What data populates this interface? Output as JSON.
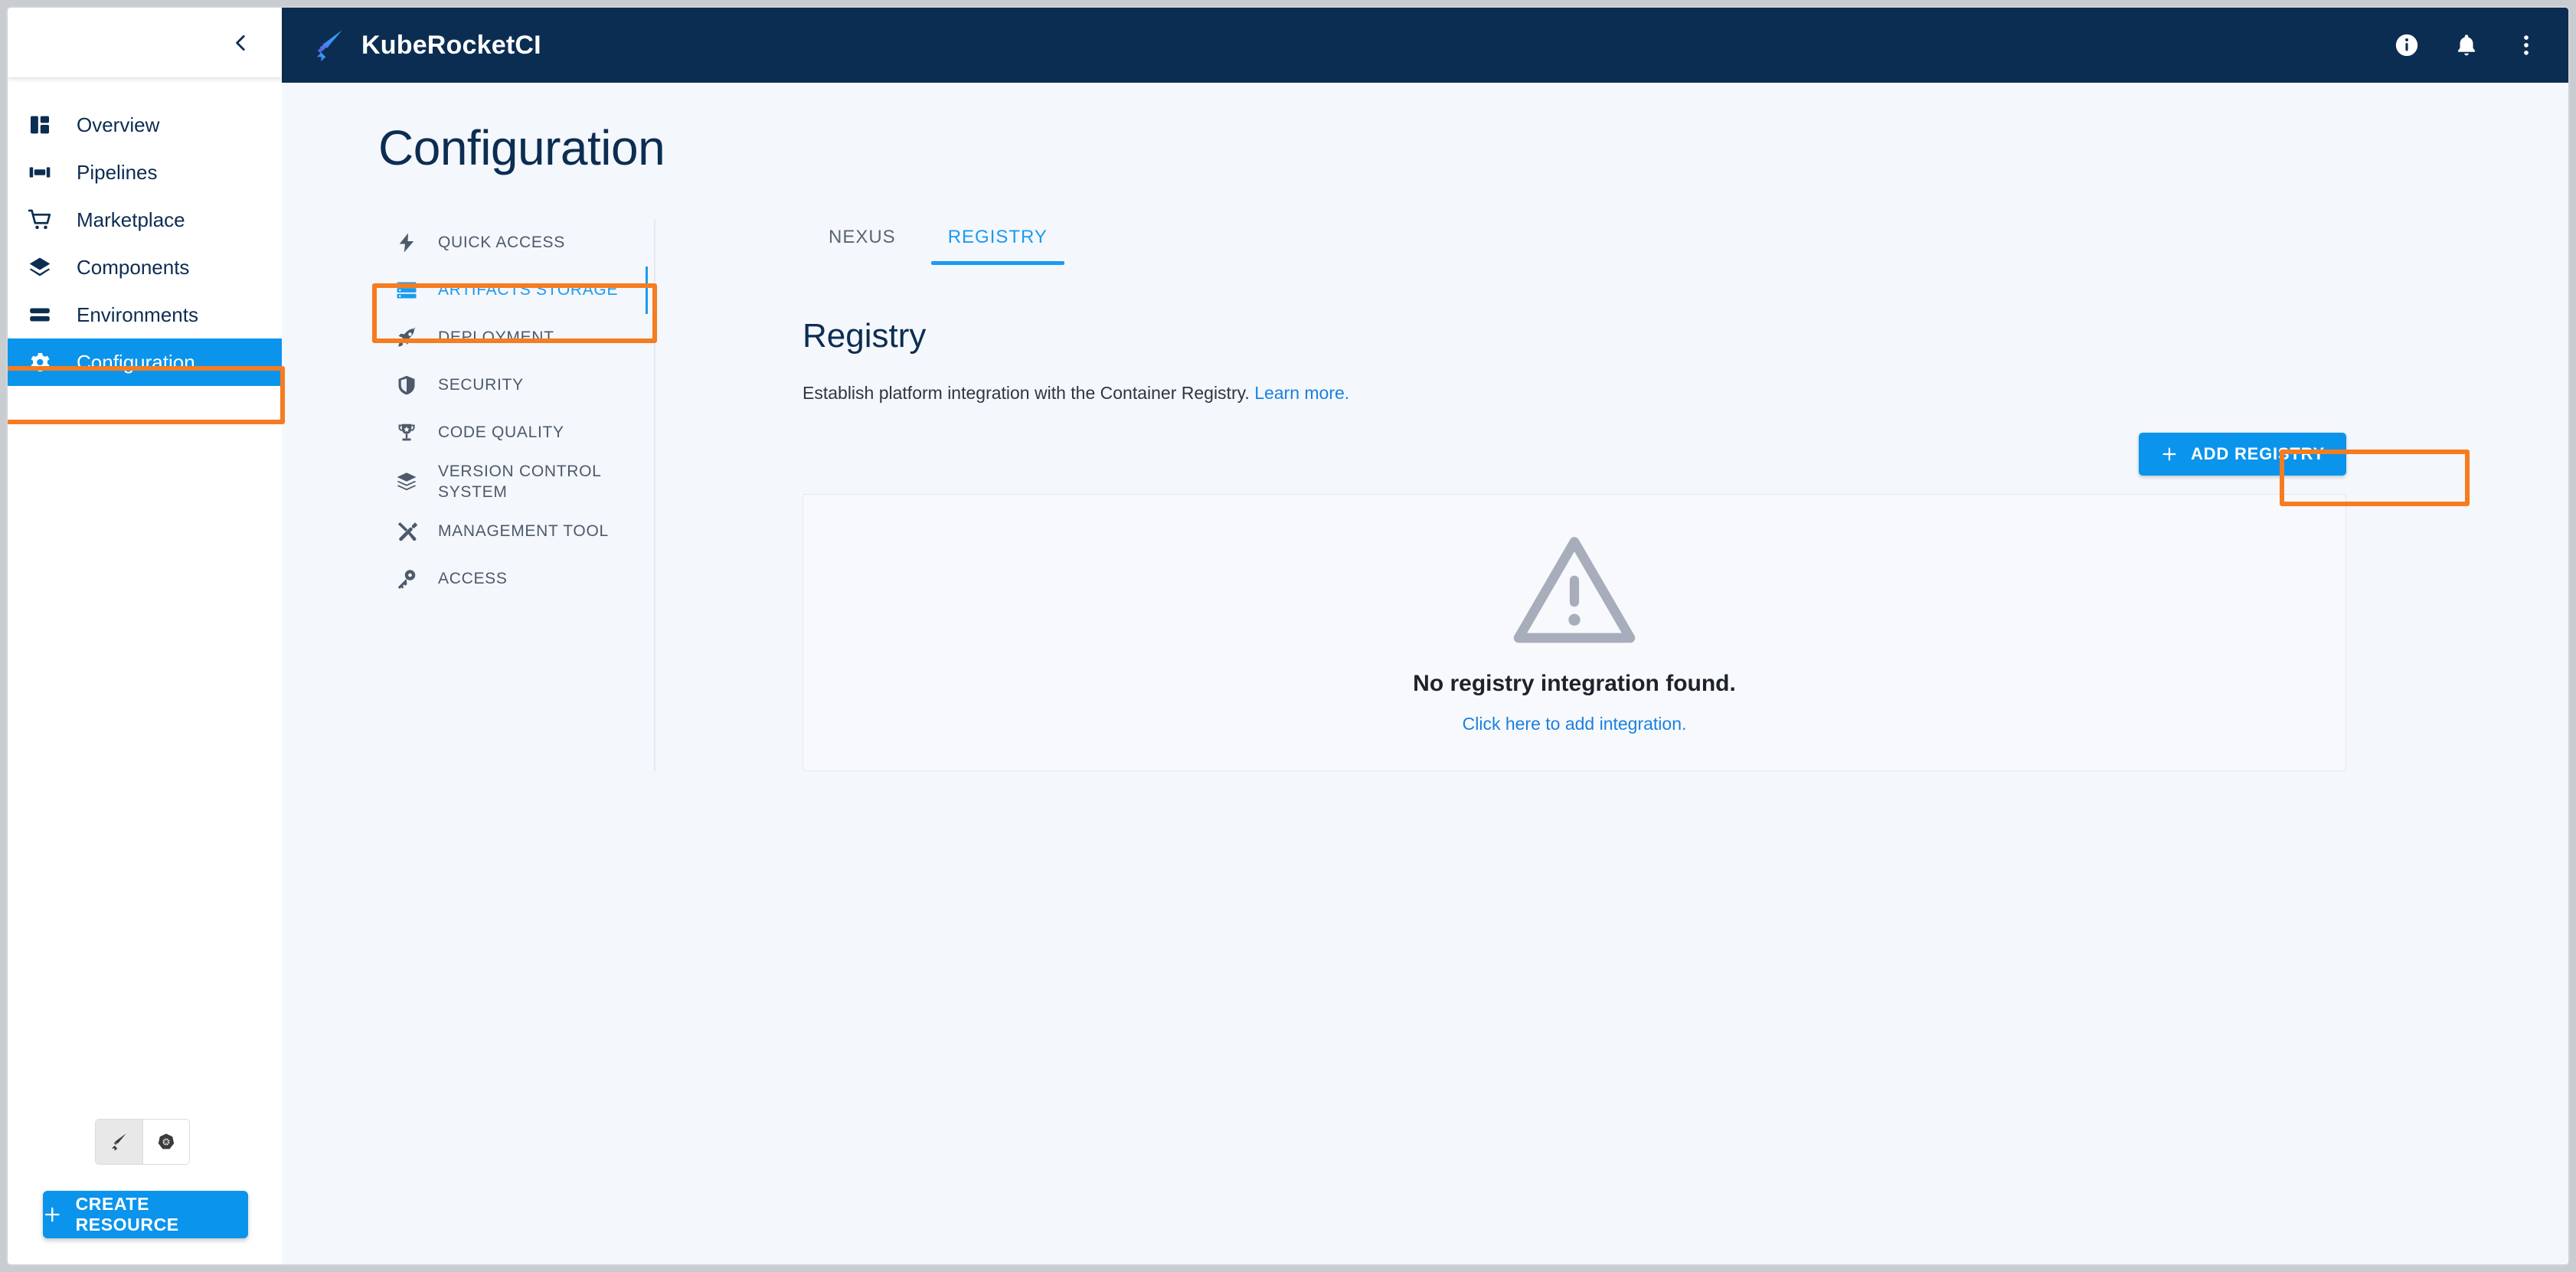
{
  "app": {
    "brand_name": "KubeRocketCI",
    "logo_icon": "rocket-logo-icon"
  },
  "topbar": {
    "icons": [
      {
        "name": "info-icon",
        "label": "Info"
      },
      {
        "name": "bell-icon",
        "label": "Notifications"
      },
      {
        "name": "more-vertical-icon",
        "label": "More options"
      }
    ]
  },
  "sidebar": {
    "collapse_icon": "chevron-left-icon",
    "items": [
      {
        "label": "Overview",
        "icon": "dashboard-icon",
        "active": false
      },
      {
        "label": "Pipelines",
        "icon": "pipelines-icon",
        "active": false
      },
      {
        "label": "Marketplace",
        "icon": "cart-icon",
        "active": false
      },
      {
        "label": "Components",
        "icon": "layers-icon",
        "active": false
      },
      {
        "label": "Environments",
        "icon": "stack-icon",
        "active": false
      },
      {
        "label": "Configuration",
        "icon": "gear-icon",
        "active": true
      }
    ],
    "view_toggle": [
      {
        "name": "rocket-view-toggle",
        "selected": true
      },
      {
        "name": "kubernetes-view-toggle",
        "selected": false
      }
    ],
    "create_resource_label": "CREATE RESOURCE",
    "create_resource_icon": "plus-icon"
  },
  "main": {
    "page_title": "Configuration",
    "config_nav": [
      {
        "label": "QUICK ACCESS",
        "icon": "lightning-icon",
        "active": false
      },
      {
        "label": "ARTIFACTS STORAGE",
        "icon": "storage-icon",
        "active": true
      },
      {
        "label": "DEPLOYMENT",
        "icon": "rocket-icon",
        "active": false
      },
      {
        "label": "SECURITY",
        "icon": "shield-icon",
        "active": false
      },
      {
        "label": "CODE QUALITY",
        "icon": "trophy-icon",
        "active": false
      },
      {
        "label": "VERSION CONTROL SYSTEM",
        "icon": "layers-stack-icon",
        "active": false
      },
      {
        "label": "MANAGEMENT TOOL",
        "icon": "tools-icon",
        "active": false
      },
      {
        "label": "ACCESS",
        "icon": "key-icon",
        "active": false
      }
    ],
    "tabs": [
      {
        "label": "NEXUS",
        "active": false
      },
      {
        "label": "REGISTRY",
        "active": true
      }
    ],
    "section_title": "Registry",
    "section_desc": "Establish platform integration with the Container Registry.",
    "learn_more_label": "Learn more.",
    "add_button_label": "ADD REGISTRY",
    "add_button_icon": "plus-icon",
    "empty_state": {
      "icon": "warning-triangle-icon",
      "title": "No registry integration found.",
      "link_label": "Click here to add integration."
    }
  },
  "colors": {
    "header_bg": "#0c2d52",
    "accent_blue": "#0b94ec",
    "link_blue": "#1b80e0",
    "tab_active": "#1b9bf0",
    "highlight_orange": "#f57c20",
    "page_bg": "#f4f7fb"
  }
}
